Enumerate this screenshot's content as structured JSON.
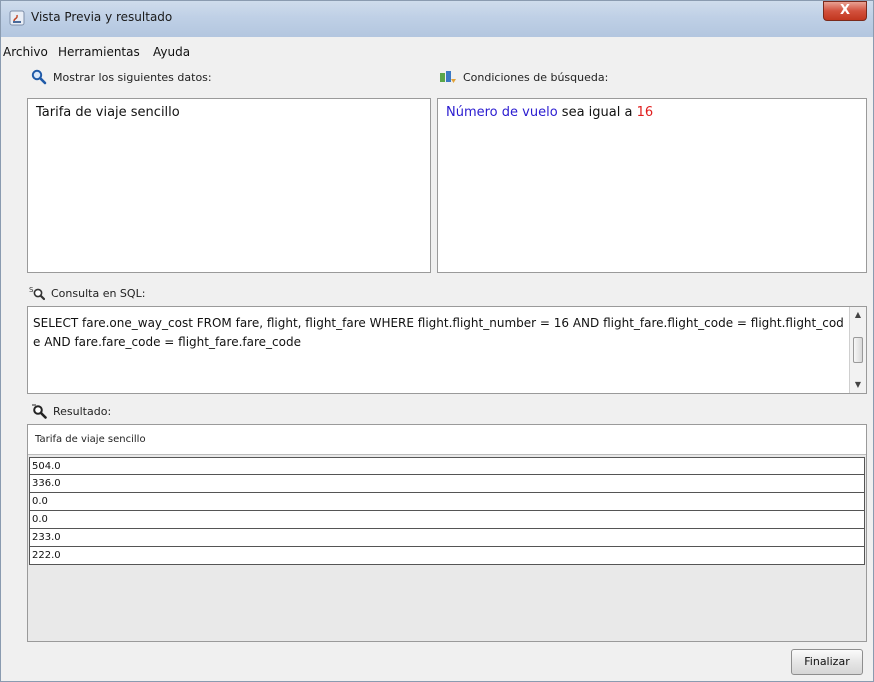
{
  "window": {
    "title": "Vista Previa y resultado",
    "close_label": "X"
  },
  "menu": [
    "Archivo",
    "Herramientas",
    "Ayuda"
  ],
  "display_panel": {
    "label": "Mostrar los siguientes datos:",
    "content": "Tarifa de viaje sencillo"
  },
  "conditions_panel": {
    "label": "Condiciones de búsqueda:",
    "field": "Número de vuelo",
    "operator": "sea igual a",
    "value": "16"
  },
  "sql_panel": {
    "label": "Consulta en SQL:",
    "query": "SELECT fare.one_way_cost FROM fare, flight, flight_fare WHERE flight.flight_number = 16 AND flight_fare.flight_code = flight.flight_code AND fare.fare_code = flight_fare.fare_code"
  },
  "result_panel": {
    "label": "Resultado:",
    "column": "Tarifa de viaje sencillo",
    "rows": [
      "504.0",
      "336.0",
      "0.0",
      "0.0",
      "233.0",
      "222.0"
    ]
  },
  "buttons": {
    "finish": "Finalizar"
  },
  "colors": {
    "condition_field": "#2a1bd0",
    "condition_value": "#e01e1e",
    "icon_blue": "#1f5aa8"
  }
}
